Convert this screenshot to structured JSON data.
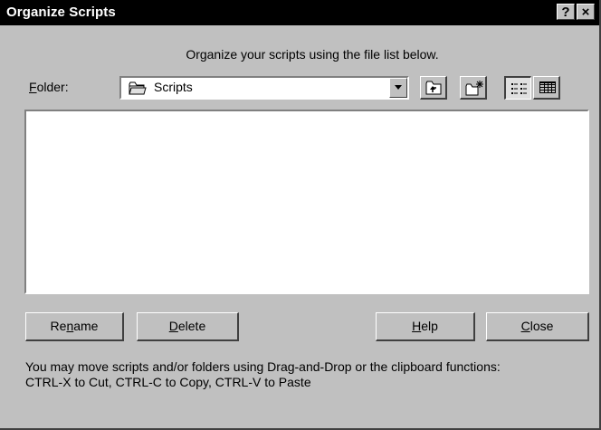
{
  "window": {
    "title": "Organize Scripts",
    "help_glyph": "?",
    "close_glyph": "×"
  },
  "instruction": "Organize your scripts using the file list below.",
  "folder": {
    "label": "Folder:",
    "selected": "Scripts",
    "icon": "folder-icon"
  },
  "toolbar": {
    "up_icon": "up-one-level-icon",
    "new_folder_icon": "new-folder-icon",
    "list_view_icon": "list-view-icon",
    "details_view_icon": "details-view-icon",
    "active_view": "list"
  },
  "buttons": {
    "rename": "Rename",
    "delete": "Delete",
    "help": "Help",
    "close": "Close"
  },
  "info": {
    "line1": "You may move scripts and/or folders using Drag-and-Drop or the clipboard functions:",
    "line2": "CTRL-X to Cut, CTRL-C to Copy, CTRL-V to Paste"
  }
}
